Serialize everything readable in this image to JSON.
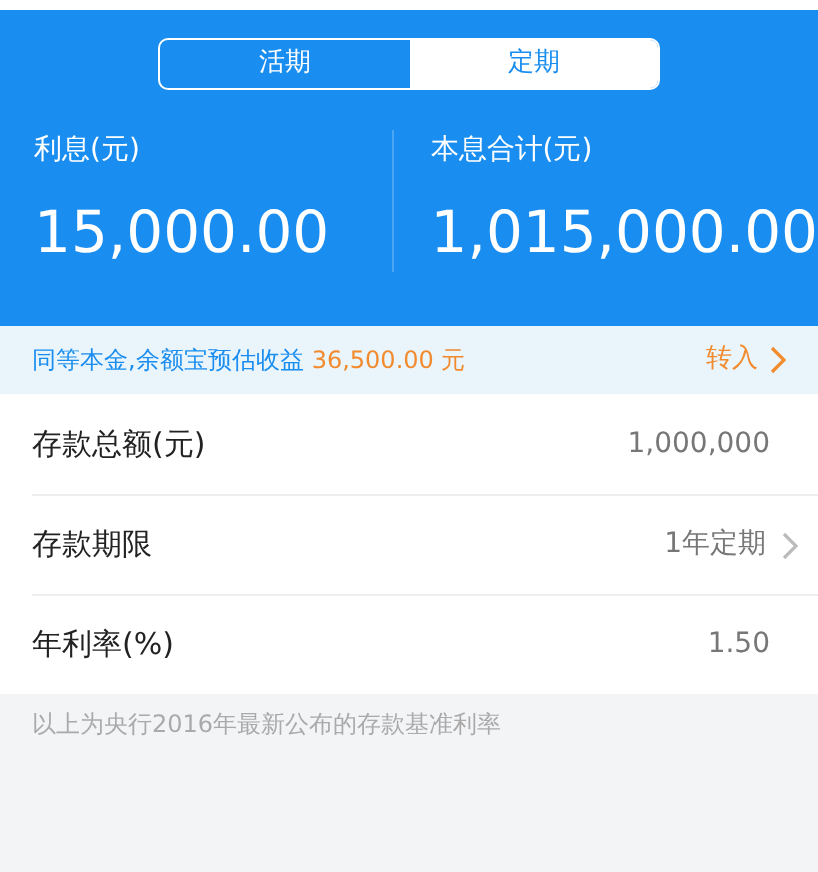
{
  "tabs": [
    {
      "label": "活期",
      "selected": false
    },
    {
      "label": "定期",
      "selected": true
    }
  ],
  "summary": [
    {
      "label": "利息(元)",
      "value": "15,000.00"
    },
    {
      "label": "本息合计(元)",
      "value": "1,015,000.00"
    }
  ],
  "banner": {
    "text": "同等本金,余额宝预估收益",
    "amount": "36,500.00 元",
    "action": "转入"
  },
  "rows": [
    {
      "label": "存款总额(元)",
      "value": "1,000,000",
      "chevron": false
    },
    {
      "label": "存款期限",
      "value": "1年定期",
      "chevron": true
    },
    {
      "label": "年利率(%)",
      "value": "1.50",
      "chevron": false
    }
  ],
  "note": "以上为央行2016年最新公布的存款基准利率"
}
